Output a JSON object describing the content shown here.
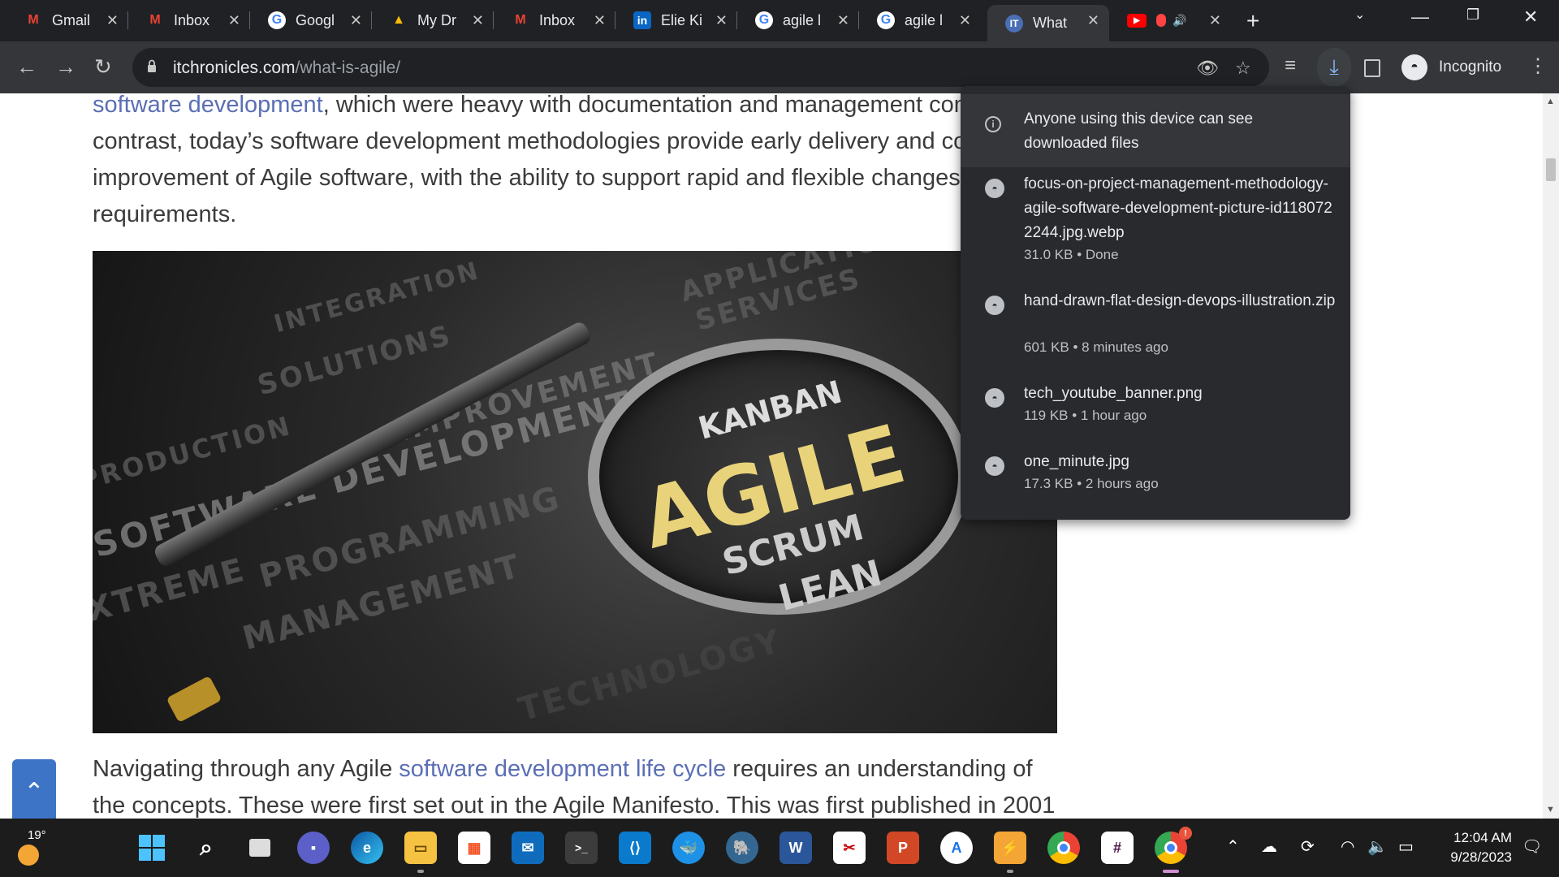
{
  "tabs": [
    {
      "label": "Gmail",
      "icon": "gmail-icon"
    },
    {
      "label": "Inbox",
      "icon": "gmail-icon"
    },
    {
      "label": "Googl",
      "icon": "google-icon"
    },
    {
      "label": "My Dr",
      "icon": "drive-icon"
    },
    {
      "label": "Inbox",
      "icon": "gmail-icon"
    },
    {
      "label": "Elie Ki",
      "icon": "linkedin-icon"
    },
    {
      "label": "agile l",
      "icon": "google-icon"
    },
    {
      "label": "agile l",
      "icon": "google-icon"
    },
    {
      "label": "What",
      "icon": "itchronicles-icon"
    },
    {
      "label": "",
      "icon": "youtube-icon"
    }
  ],
  "address_bar": {
    "domain": "itchronicles.com",
    "path": "/what-is-agile/"
  },
  "profile": {
    "label": "Incognito"
  },
  "article": {
    "p1_link1": "software development",
    "p1_text1": ", which were heavy with documentation and management cont",
    "p1_line2": "contrast, today’s software development methodologies provide early delivery and co",
    "p1_line3": "improvement of Agile software, with the ability to support rapid and flexible changes t",
    "p1_line4": "requirements.",
    "p2_text1": "Navigating through any Agile ",
    "p2_link": "software development life cycle",
    "p2_text2": " requires an understanding of",
    "p2_line2": "the concepts. These were first set out in the Agile Manifesto. This was first published in 2001"
  },
  "hero_image": {
    "words_bg": [
      "INTEGRATION",
      "SOLUTIONS",
      "IMPROVEMENT",
      "SOFTWARE DEVELOPMENT",
      "PROGRAMMING",
      "MANAGEMENT",
      "APPLICATION",
      "SERVICES",
      "TECHNOLOGY",
      "PRODUCTION",
      "XTREME"
    ],
    "words_lens": [
      "KANBAN",
      "AGILE",
      "SCRUM",
      "LEAN"
    ]
  },
  "downloads": {
    "notice": "Anyone using this device can see downloaded files",
    "items": [
      {
        "name": "focus-on-project-management-methodology-agile-software-development-picture-id1180722244.jpg.webp",
        "meta": "31.0 KB • Done"
      },
      {
        "name": "hand-drawn-flat-design-devops-illustration.zip",
        "meta": "601 KB • 8 minutes ago"
      },
      {
        "name": "tech_youtube_banner.png",
        "meta": "119 KB • 1 hour ago"
      },
      {
        "name": "one_minute.jpg",
        "meta": "17.3 KB • 2 hours ago"
      }
    ]
  },
  "taskbar": {
    "weather_temp": "19°",
    "time": "12:04 AM",
    "date": "9/28/2023",
    "apps": [
      "start-icon",
      "search-icon",
      "task-view-icon",
      "teams-chat-icon",
      "edge-icon",
      "file-explorer-icon",
      "microsoft-store-icon",
      "mail-icon",
      "terminal-icon",
      "vscode-icon",
      "docker-icon",
      "postgres-icon",
      "word-icon",
      "snipping-tool-icon",
      "powerpoint-icon",
      "app-store-icon",
      "folder-sync-icon",
      "chrome-icon",
      "slack-icon",
      "chrome-notification-icon"
    ]
  },
  "colors": {
    "link": "#5b6fb5",
    "agile_gold": "#e8d37a",
    "download_accent": "#8ab4f8"
  }
}
